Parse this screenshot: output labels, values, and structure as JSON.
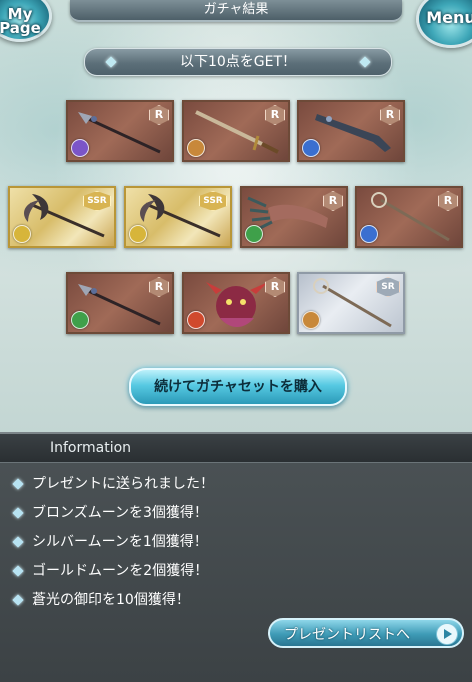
{
  "header": {
    "title": "ガチャ結果",
    "mypage_label": "My Page",
    "menu_label": "Menu"
  },
  "banner": {
    "text": "以下10点をGET！"
  },
  "items": [
    {
      "rarity": "R",
      "element": "dark",
      "element_color": "#7b55c8",
      "weapon": "spear"
    },
    {
      "rarity": "R",
      "element": "light",
      "element_color": "#c8883a",
      "weapon": "sword"
    },
    {
      "rarity": "R",
      "element": "water",
      "element_color": "#3a6fd0",
      "weapon": "gun"
    },
    {
      "rarity": "SSR",
      "element": "light",
      "element_color": "#d7b53a",
      "weapon": "axe"
    },
    {
      "rarity": "SSR",
      "element": "light",
      "element_color": "#d7b53a",
      "weapon": "axe"
    },
    {
      "rarity": "R",
      "element": "wind",
      "element_color": "#3fa04a",
      "weapon": "claw"
    },
    {
      "rarity": "R",
      "element": "water",
      "element_color": "#3a6fd0",
      "weapon": "staff"
    },
    {
      "rarity": "R",
      "element": "wind",
      "element_color": "#3fa04a",
      "weapon": "spear"
    },
    {
      "rarity": "R",
      "element": "fire",
      "element_color": "#d0492d",
      "weapon": "summon"
    },
    {
      "rarity": "SR",
      "element": "light",
      "element_color": "#c8883a",
      "weapon": "staff"
    }
  ],
  "buy_button": {
    "label": "続けてガチャセットを購入"
  },
  "information": {
    "title": "Information",
    "lines": [
      "プレゼントに送られました！",
      "ブロンズムーンを3個獲得！",
      "シルバームーンを1個獲得！",
      "ゴールドムーンを2個獲得！",
      "蒼光の御印を10個獲得！"
    ],
    "present_button": "プレゼントリストへ"
  }
}
